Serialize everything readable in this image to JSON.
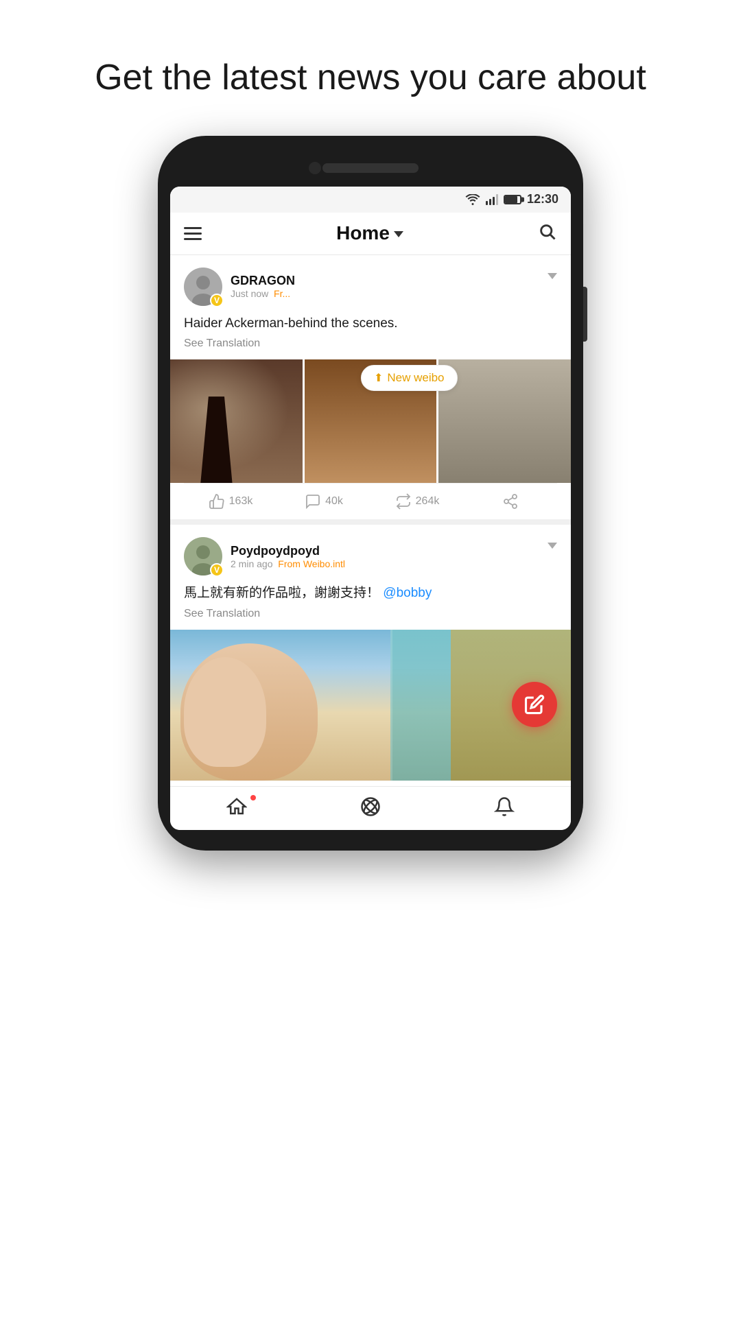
{
  "page": {
    "headline": "Get the latest news you care about"
  },
  "statusBar": {
    "time": "12:30"
  },
  "header": {
    "title": "Home",
    "menuLabel": "Menu",
    "searchLabel": "Search"
  },
  "newWeiboBadge": {
    "label": "New weibo"
  },
  "posts": [
    {
      "id": "post1",
      "author": "GDRAGON",
      "verified": "V",
      "time": "Just now",
      "source": "Fr...",
      "text": "Haider Ackerman-behind the scenes.",
      "seeTranslation": "See Translation",
      "likes": "163k",
      "comments": "40k",
      "reposts": "264k",
      "images": 3
    },
    {
      "id": "post2",
      "author": "Poydpoydpoyd",
      "verified": "V",
      "time": "2 min ago",
      "source": "From Weibo.intl",
      "text": "馬上就有新的作品啦，謝謝支持！",
      "mention": "@bobby",
      "seeTranslation": "See Translation",
      "images": 1
    }
  ],
  "bottomNav": {
    "home": "home",
    "discover": "discover",
    "notifications": "notifications"
  },
  "fab": {
    "label": "Compose"
  }
}
